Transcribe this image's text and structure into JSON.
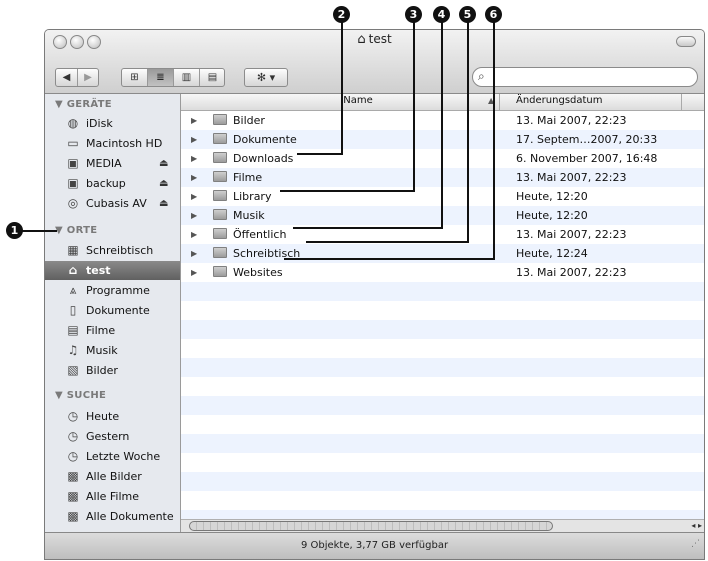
{
  "window": {
    "title": "test",
    "status": "9 Objekte, 3,77 GB verfügbar"
  },
  "toolbar": {
    "back": "◀",
    "forward": "▶",
    "view_icon": "⊞",
    "view_list": "≣",
    "view_columns": "▥",
    "view_coverflow": "▤",
    "action": "✻ ▾",
    "search_placeholder": ""
  },
  "sidebar": {
    "devices_header": "▼ GERÄTE",
    "devices": [
      {
        "label": "iDisk",
        "icon": "globe-icon",
        "eject": false
      },
      {
        "label": "Macintosh HD",
        "icon": "hard-drive-icon",
        "eject": false
      },
      {
        "label": "MEDIA",
        "icon": "drive-icon",
        "eject": true
      },
      {
        "label": "backup",
        "icon": "drive-icon",
        "eject": true
      },
      {
        "label": "Cubasis AV",
        "icon": "cd-icon",
        "eject": true
      }
    ],
    "places_header": "▼ ORTE",
    "places": [
      {
        "label": "Schreibtisch",
        "icon": "desktop-icon"
      },
      {
        "label": "test",
        "icon": "home-icon",
        "selected": true
      },
      {
        "label": "Programme",
        "icon": "applications-icon"
      },
      {
        "label": "Dokumente",
        "icon": "document-icon"
      },
      {
        "label": "Filme",
        "icon": "film-icon"
      },
      {
        "label": "Musik",
        "icon": "music-icon"
      },
      {
        "label": "Bilder",
        "icon": "pictures-icon"
      }
    ],
    "search_header": "▼ SUCHE",
    "searches": [
      {
        "label": "Heute",
        "icon": "clock-icon"
      },
      {
        "label": "Gestern",
        "icon": "clock-icon"
      },
      {
        "label": "Letzte Woche",
        "icon": "clock-icon"
      },
      {
        "label": "Alle Bilder",
        "icon": "smart-folder-icon"
      },
      {
        "label": "Alle Filme",
        "icon": "smart-folder-icon"
      },
      {
        "label": "Alle Dokumente",
        "icon": "smart-folder-icon"
      }
    ]
  },
  "list": {
    "col_name": "Name",
    "col_date": "Änderungsdatum",
    "rows": [
      {
        "name": "Bilder",
        "date": "13. Mai 2007, 22:23"
      },
      {
        "name": "Dokumente",
        "date": "17. Septem…2007, 20:33"
      },
      {
        "name": "Downloads",
        "date": "6. November 2007, 16:48"
      },
      {
        "name": "Filme",
        "date": "13. Mai 2007, 22:23"
      },
      {
        "name": "Library",
        "date": "Heute, 12:20"
      },
      {
        "name": "Musik",
        "date": "Heute, 12:20"
      },
      {
        "name": "Öffentlich",
        "date": "13. Mai 2007, 22:23"
      },
      {
        "name": "Schreibtisch",
        "date": "Heute, 12:24"
      },
      {
        "name": "Websites",
        "date": "13. Mai 2007, 22:23"
      }
    ]
  },
  "callouts": [
    "1",
    "2",
    "3",
    "4",
    "5",
    "6"
  ]
}
